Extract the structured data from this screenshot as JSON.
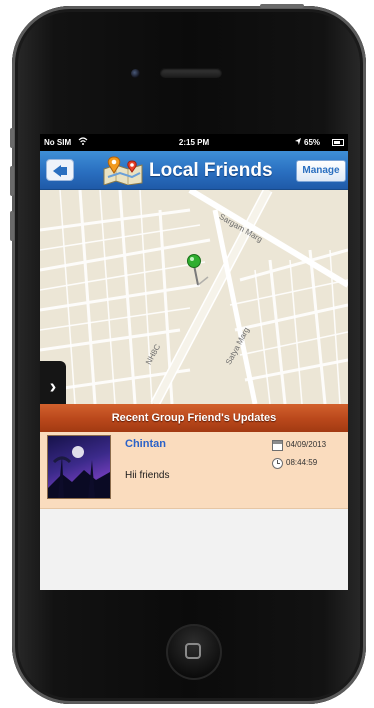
{
  "status_bar": {
    "carrier": "No SIM",
    "wifi_icon": "wifi-icon",
    "time": "2:15 PM",
    "location_icon": "location-arrow-icon",
    "battery": "65%",
    "battery_level": 0.65
  },
  "nav": {
    "back_icon": "back-arrow-icon",
    "title_icon": "map-pin-icon",
    "title": "Local Friends",
    "manage_label": "Manage"
  },
  "map": {
    "streets": [
      "Sargam Marg",
      "NH8C",
      "Satya Marg"
    ],
    "pin_icon": "green-map-pin-icon",
    "side_tab_icon": "chevron-right-icon"
  },
  "updates": {
    "header": "Recent Group Friend's Updates",
    "items": [
      {
        "name": "Chintan",
        "message": "Hii friends",
        "date": "04/09/2013",
        "time": "08:44:59",
        "date_icon": "calendar-icon",
        "time_icon": "clock-icon"
      }
    ]
  },
  "colors": {
    "navbar": "#2a6fc0",
    "updates_header": "#b9471b",
    "update_row": "#fadcbe",
    "friend_name": "#2b62c8"
  }
}
